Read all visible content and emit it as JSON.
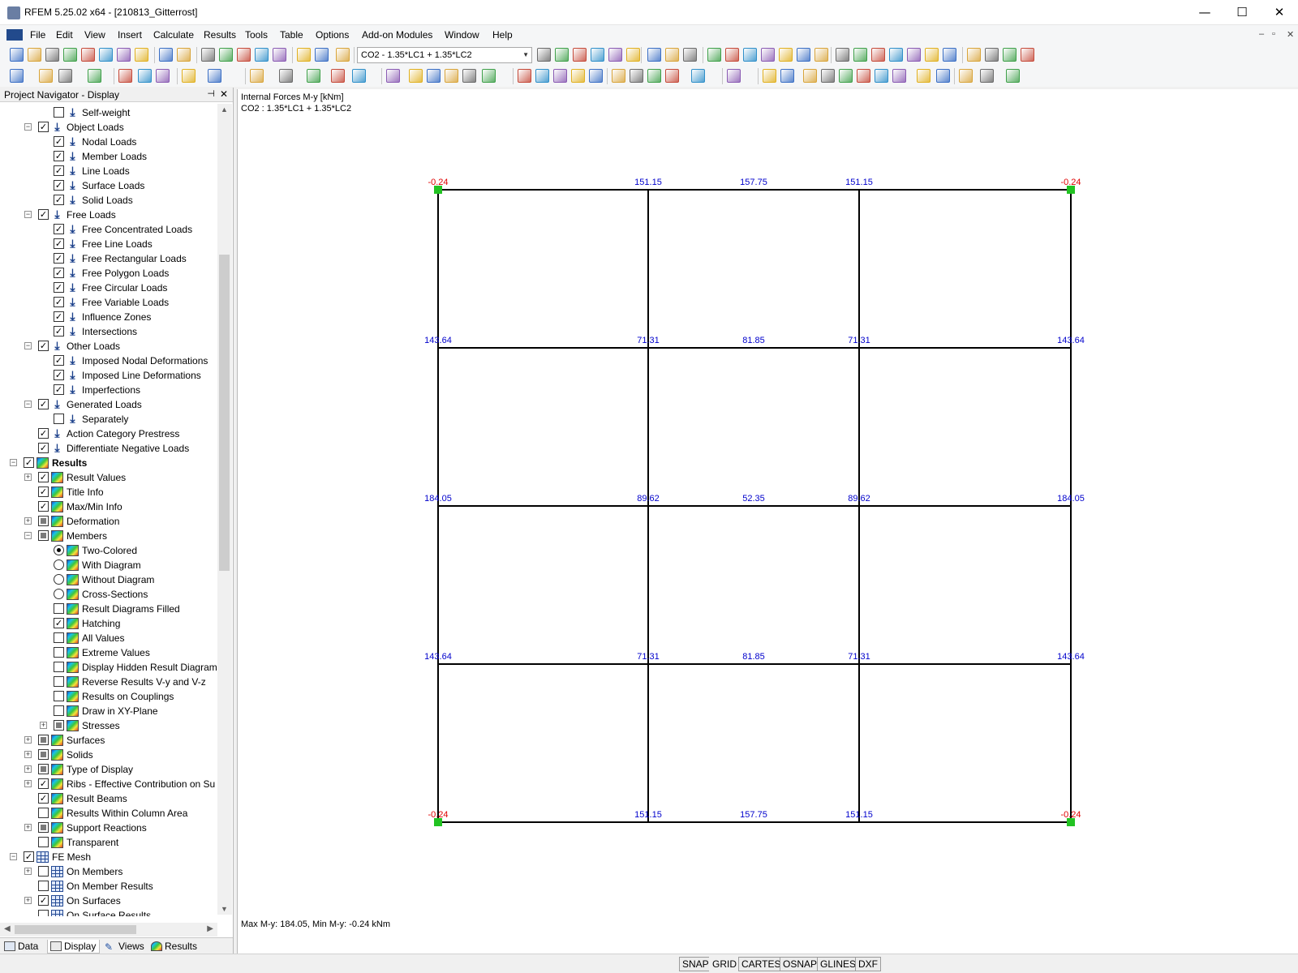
{
  "window": {
    "title": "RFEM 5.25.02 x64 - [210813_Gitterrost]"
  },
  "menu": [
    "File",
    "Edit",
    "View",
    "Insert",
    "Calculate",
    "Results",
    "Tools",
    "Table",
    "Options",
    "Add-on Modules",
    "Window",
    "Help"
  ],
  "toolbar": {
    "load_combo": "CO2 - 1.35*LC1 + 1.35*LC2"
  },
  "navigator": {
    "title": "Project Navigator - Display",
    "tabs": [
      "Data",
      "Display",
      "Views",
      "Results"
    ],
    "items": [
      {
        "label": "Self-weight",
        "level": 2,
        "check": "off",
        "icon": "load"
      },
      {
        "label": "Object Loads",
        "level": 1,
        "check": "on",
        "icon": "load",
        "exp": "-"
      },
      {
        "label": "Nodal Loads",
        "level": 2,
        "check": "on",
        "icon": "load"
      },
      {
        "label": "Member Loads",
        "level": 2,
        "check": "on",
        "icon": "load"
      },
      {
        "label": "Line Loads",
        "level": 2,
        "check": "on",
        "icon": "load"
      },
      {
        "label": "Surface Loads",
        "level": 2,
        "check": "on",
        "icon": "load"
      },
      {
        "label": "Solid Loads",
        "level": 2,
        "check": "on",
        "icon": "load"
      },
      {
        "label": "Free Loads",
        "level": 1,
        "check": "on",
        "icon": "load",
        "exp": "-"
      },
      {
        "label": "Free Concentrated Loads",
        "level": 2,
        "check": "on",
        "icon": "load"
      },
      {
        "label": "Free Line Loads",
        "level": 2,
        "check": "on",
        "icon": "load"
      },
      {
        "label": "Free Rectangular Loads",
        "level": 2,
        "check": "on",
        "icon": "load"
      },
      {
        "label": "Free Polygon Loads",
        "level": 2,
        "check": "on",
        "icon": "load"
      },
      {
        "label": "Free Circular Loads",
        "level": 2,
        "check": "on",
        "icon": "load"
      },
      {
        "label": "Free Variable Loads",
        "level": 2,
        "check": "on",
        "icon": "load"
      },
      {
        "label": "Influence Zones",
        "level": 2,
        "check": "on",
        "icon": "load"
      },
      {
        "label": "Intersections",
        "level": 2,
        "check": "on",
        "icon": "load"
      },
      {
        "label": "Other Loads",
        "level": 1,
        "check": "on",
        "icon": "load",
        "exp": "-"
      },
      {
        "label": "Imposed Nodal Deformations",
        "level": 2,
        "check": "on",
        "icon": "load"
      },
      {
        "label": "Imposed Line Deformations",
        "level": 2,
        "check": "on",
        "icon": "load"
      },
      {
        "label": "Imperfections",
        "level": 2,
        "check": "on",
        "icon": "load"
      },
      {
        "label": "Generated Loads",
        "level": 1,
        "check": "on",
        "icon": "load",
        "exp": "-"
      },
      {
        "label": "Separately",
        "level": 2,
        "check": "off",
        "icon": "load"
      },
      {
        "label": "Action Category Prestress",
        "level": 1,
        "check": "on",
        "icon": "load"
      },
      {
        "label": "Differentiate Negative Loads",
        "level": 1,
        "check": "on",
        "icon": "load"
      },
      {
        "label": "Results",
        "level": 0,
        "check": "on",
        "icon": "res",
        "exp": "-",
        "bold": true
      },
      {
        "label": "Result Values",
        "level": 1,
        "check": "on",
        "icon": "res",
        "exp": "+"
      },
      {
        "label": "Title Info",
        "level": 1,
        "check": "on",
        "icon": "res"
      },
      {
        "label": "Max/Min Info",
        "level": 1,
        "check": "on",
        "icon": "res"
      },
      {
        "label": "Deformation",
        "level": 1,
        "check": "ind",
        "icon": "res",
        "exp": "+"
      },
      {
        "label": "Members",
        "level": 1,
        "check": "ind",
        "icon": "res",
        "exp": "-"
      },
      {
        "label": "Two-Colored",
        "level": 2,
        "check": "radio-on",
        "icon": "res"
      },
      {
        "label": "With Diagram",
        "level": 2,
        "check": "radio",
        "icon": "res"
      },
      {
        "label": "Without Diagram",
        "level": 2,
        "check": "radio",
        "icon": "res"
      },
      {
        "label": "Cross-Sections",
        "level": 2,
        "check": "radio",
        "icon": "res"
      },
      {
        "label": "Result Diagrams Filled",
        "level": 2,
        "check": "off",
        "icon": "res"
      },
      {
        "label": "Hatching",
        "level": 2,
        "check": "on",
        "icon": "res"
      },
      {
        "label": "All Values",
        "level": 2,
        "check": "off",
        "icon": "res"
      },
      {
        "label": "Extreme Values",
        "level": 2,
        "check": "off",
        "icon": "res"
      },
      {
        "label": "Display Hidden Result Diagram",
        "level": 2,
        "check": "off",
        "icon": "res"
      },
      {
        "label": "Reverse Results V-y and V-z",
        "level": 2,
        "check": "off",
        "icon": "res"
      },
      {
        "label": "Results on Couplings",
        "level": 2,
        "check": "off",
        "icon": "res"
      },
      {
        "label": "Draw in XY-Plane",
        "level": 2,
        "check": "off",
        "icon": "res"
      },
      {
        "label": "Stresses",
        "level": 2,
        "check": "ind",
        "icon": "res",
        "exp": "+"
      },
      {
        "label": "Surfaces",
        "level": 1,
        "check": "ind",
        "icon": "res",
        "exp": "+"
      },
      {
        "label": "Solids",
        "level": 1,
        "check": "ind",
        "icon": "res",
        "exp": "+"
      },
      {
        "label": "Type of Display",
        "level": 1,
        "check": "ind",
        "icon": "res",
        "exp": "+"
      },
      {
        "label": "Ribs - Effective Contribution on Su",
        "level": 1,
        "check": "on",
        "icon": "res",
        "exp": "+"
      },
      {
        "label": "Result Beams",
        "level": 1,
        "check": "on",
        "icon": "res"
      },
      {
        "label": "Results Within Column Area",
        "level": 1,
        "check": "off",
        "icon": "res"
      },
      {
        "label": "Support Reactions",
        "level": 1,
        "check": "ind",
        "icon": "res",
        "exp": "+"
      },
      {
        "label": "Transparent",
        "level": 1,
        "check": "off",
        "icon": "res"
      },
      {
        "label": "FE Mesh",
        "level": 0,
        "check": "on",
        "icon": "mesh",
        "exp": "-"
      },
      {
        "label": "On Members",
        "level": 1,
        "check": "off",
        "icon": "mesh",
        "exp": "+"
      },
      {
        "label": "On Member Results",
        "level": 1,
        "check": "off",
        "icon": "mesh"
      },
      {
        "label": "On Surfaces",
        "level": 1,
        "check": "on",
        "icon": "mesh",
        "exp": "+"
      },
      {
        "label": "On Surface Results",
        "level": 1,
        "check": "off",
        "icon": "mesh"
      }
    ]
  },
  "viewport": {
    "info_line1": "Internal Forces M-y [kNm]",
    "info_line2": "CO2 : 1.35*LC1 + 1.35*LC2",
    "maxmin": "Max M-y: 184.05, Min M-y: -0.24 kNm",
    "colors": {
      "frame": "#000000",
      "value": "#0000cc",
      "negative": "#e00000",
      "support": "#22c322"
    },
    "grid_rows": [
      {
        "values": [
          "-0.24",
          "151.15",
          "157.75",
          "151.15",
          "-0.24"
        ],
        "neg": [
          true,
          false,
          false,
          false,
          true
        ]
      },
      {
        "values": [
          "143.64",
          "71.31",
          "81.85",
          "71.31",
          "143.64"
        ],
        "neg": [
          false,
          false,
          false,
          false,
          false
        ]
      },
      {
        "values": [
          "184.05",
          "89.62",
          "52.35",
          "89.62",
          "184.05"
        ],
        "neg": [
          false,
          false,
          false,
          false,
          false
        ]
      },
      {
        "values": [
          "143.64",
          "71.31",
          "81.85",
          "71.31",
          "143.64"
        ],
        "neg": [
          false,
          false,
          false,
          false,
          false
        ]
      },
      {
        "values": [
          "-0.24",
          "151.15",
          "157.75",
          "151.15",
          "-0.24"
        ],
        "neg": [
          true,
          false,
          false,
          false,
          true
        ]
      }
    ]
  },
  "statusbar": [
    "SNAP",
    "GRID",
    "CARTES",
    "OSNAP",
    "GLINES",
    "DXF"
  ]
}
